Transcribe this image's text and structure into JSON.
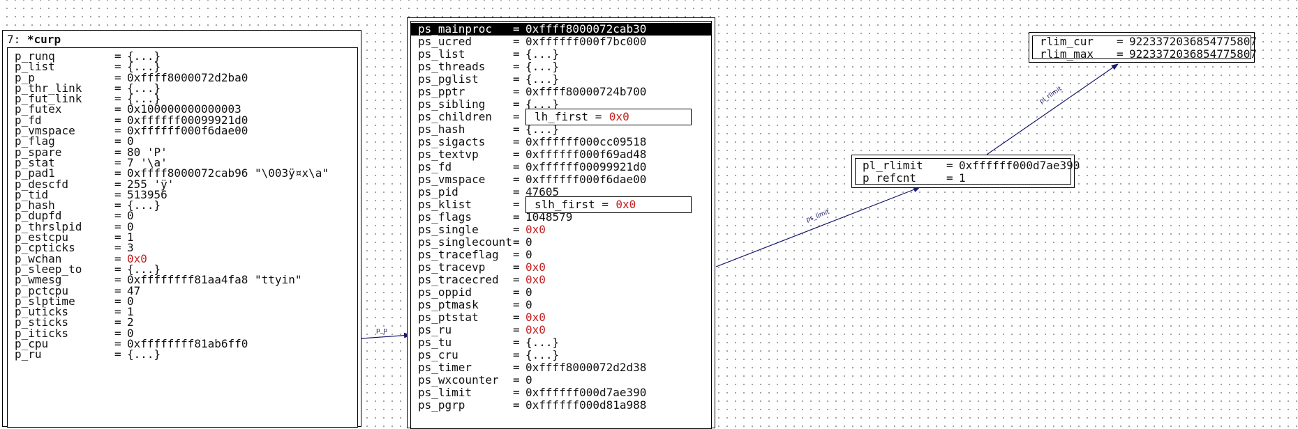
{
  "curp_node": {
    "index_label": "7: ",
    "title": "*curp",
    "fields": [
      {
        "name": "p_runq",
        "value": "{...}"
      },
      {
        "name": "p_list",
        "value": "{...}"
      },
      {
        "name": "p_p",
        "value": "0xffff8000072d2ba0"
      },
      {
        "name": "p_thr_link",
        "value": "{...}"
      },
      {
        "name": "p_fut_link",
        "value": "{...}"
      },
      {
        "name": "p_futex",
        "value": "0x100000000000003"
      },
      {
        "name": "p_fd",
        "value": "0xffffff00099921d0"
      },
      {
        "name": "p_vmspace",
        "value": "0xffffff000f6dae00"
      },
      {
        "name": "p_flag",
        "value": "0"
      },
      {
        "name": "p_spare",
        "value": "80 'P'"
      },
      {
        "name": "p_stat",
        "value": "7 '\\a'"
      },
      {
        "name": "p_pad1",
        "value": "0xffff8000072cab96 \"\\003ÿ¤x\\a\""
      },
      {
        "name": "p_descfd",
        "value": "255 'ÿ'"
      },
      {
        "name": "p_tid",
        "value": "513956"
      },
      {
        "name": "p_hash",
        "value": "{...}"
      },
      {
        "name": "p_dupfd",
        "value": "0"
      },
      {
        "name": "p_thrslpid",
        "value": "0"
      },
      {
        "name": "p_estcpu",
        "value": "1"
      },
      {
        "name": "p_cpticks",
        "value": "3"
      },
      {
        "name": "p_wchan",
        "value": "0x0",
        "null": true
      },
      {
        "name": "p_sleep_to",
        "value": "{...}"
      },
      {
        "name": "p_wmesg",
        "value": "0xffffffff81aa4fa8 \"ttyin\""
      },
      {
        "name": "p_pctcpu",
        "value": "47"
      },
      {
        "name": "p_slptime",
        "value": "0"
      },
      {
        "name": "p_uticks",
        "value": "1"
      },
      {
        "name": "p_sticks",
        "value": "2"
      },
      {
        "name": "p_iticks",
        "value": "0"
      },
      {
        "name": "p_cpu",
        "value": "0xffffffff81ab6ff0"
      },
      {
        "name": "p_ru",
        "value": "{...}"
      }
    ]
  },
  "ps_node": {
    "fields": [
      {
        "name": "ps_mainproc",
        "value": "0xffff8000072cab30",
        "selected": true
      },
      {
        "name": "ps_ucred",
        "value": "0xffffff000f7bc000"
      },
      {
        "name": "ps_list",
        "value": "{...}"
      },
      {
        "name": "ps_threads",
        "value": "{...}"
      },
      {
        "name": "ps_pglist",
        "value": "{...}"
      },
      {
        "name": "ps_pptr",
        "value": "0xffff80000724b700"
      },
      {
        "name": "ps_sibling",
        "value": "{...}"
      },
      {
        "name": "ps_children",
        "struct": {
          "name": "lh_first",
          "value": "0x0"
        }
      },
      {
        "name": "ps_hash",
        "value": "{...}"
      },
      {
        "name": "ps_sigacts",
        "value": "0xffffff000cc09518"
      },
      {
        "name": "ps_textvp",
        "value": "0xffffff000f69ad48"
      },
      {
        "name": "ps_fd",
        "value": "0xffffff00099921d0"
      },
      {
        "name": "ps_vmspace",
        "value": "0xffffff000f6dae00"
      },
      {
        "name": "ps_pid",
        "value": "47605"
      },
      {
        "name": "ps_klist",
        "struct": {
          "name": "slh_first",
          "value": "0x0"
        }
      },
      {
        "name": "ps_flags",
        "value": "1048579"
      },
      {
        "name": "ps_single",
        "value": "0x0",
        "null": true
      },
      {
        "name": "ps_singlecount",
        "value": "0"
      },
      {
        "name": "ps_traceflag",
        "value": "0"
      },
      {
        "name": "ps_tracevp",
        "value": "0x0",
        "null": true
      },
      {
        "name": "ps_tracecred",
        "value": "0x0",
        "null": true
      },
      {
        "name": "ps_oppid",
        "value": "0"
      },
      {
        "name": "ps_ptmask",
        "value": "0"
      },
      {
        "name": "ps_ptstat",
        "value": "0x0",
        "null": true
      },
      {
        "name": "ps_ru",
        "value": "0x0",
        "null": true
      },
      {
        "name": "ps_tu",
        "value": "{...}"
      },
      {
        "name": "ps_cru",
        "value": "{...}"
      },
      {
        "name": "ps_timer",
        "value": "0xffff8000072d2d38"
      },
      {
        "name": "ps_wxcounter",
        "value": "0"
      },
      {
        "name": "ps_limit",
        "value": "0xffffff000d7ae390"
      },
      {
        "name": "ps_pgrp",
        "value": "0xffffff000d81a988"
      }
    ]
  },
  "plimit_node": {
    "fields": [
      {
        "name": "pl_rlimit",
        "value": "0xffffff000d7ae390"
      },
      {
        "name": "p_refcnt",
        "value": "1"
      }
    ]
  },
  "rlimit_node": {
    "fields": [
      {
        "name": "rlim_cur",
        "value": "9223372036854775807"
      },
      {
        "name": "rlim_max",
        "value": "9223372036854775807"
      }
    ]
  },
  "edges": {
    "p_p": "p_p",
    "ps_limit": "ps_limit",
    "pl_rlimit": "pl_rlimit"
  },
  "colors": {
    "null_value": "#c41e1e",
    "edge": "#1a1a6e",
    "grid_dot": "#8a8a8a"
  }
}
